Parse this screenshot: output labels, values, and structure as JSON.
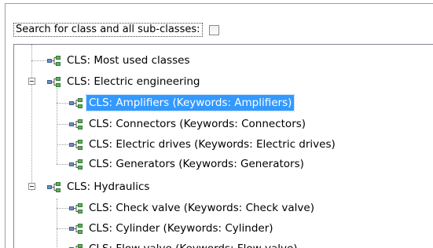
{
  "search": {
    "label": "Search for class and all sub-classes:",
    "checked": false
  },
  "tree": {
    "items": [
      {
        "label": "CLS: Most used classes",
        "level": 0,
        "icon": "class-node-icon"
      },
      {
        "label": "CLS: Electric engineering",
        "level": 0,
        "expanded": true,
        "icon": "class-node-icon"
      },
      {
        "label": "CLS: Amplifiers (Keywords: Amplifiers)",
        "level": 1,
        "selected": true,
        "icon": "class-node-icon"
      },
      {
        "label": "CLS: Connectors (Keywords: Connectors)",
        "level": 1,
        "icon": "class-node-icon"
      },
      {
        "label": "CLS: Electric drives (Keywords: Electric drives)",
        "level": 1,
        "icon": "class-node-icon"
      },
      {
        "label": "CLS: Generators (Keywords: Generators)",
        "level": 1,
        "icon": "class-node-icon"
      },
      {
        "label": "CLS: Hydraulics",
        "level": 0,
        "expanded": true,
        "icon": "class-node-icon"
      },
      {
        "label": "CLS: Check valve (Keywords: Check valve)",
        "level": 1,
        "icon": "class-node-icon"
      },
      {
        "label": "CLS: Cylinder (Keywords: Cylinder)",
        "level": 1,
        "icon": "class-node-icon"
      },
      {
        "label": "CLS: Flow valve (Keywords: Flow valve)",
        "level": 1,
        "icon": "class-node-icon"
      }
    ]
  }
}
